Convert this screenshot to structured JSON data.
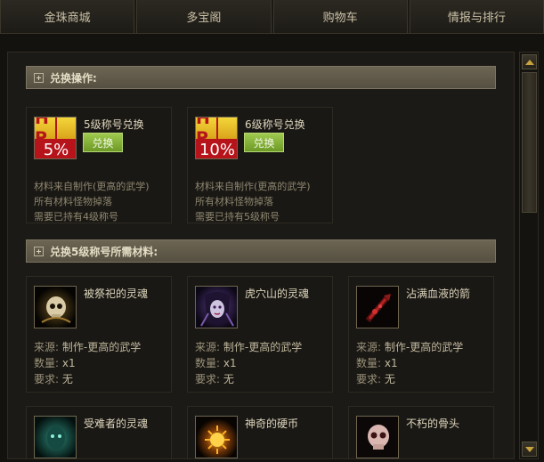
{
  "tabs": [
    "金珠商城",
    "多宝阁",
    "购物车",
    "情报与排行"
  ],
  "sections": {
    "exchange": "兑换操作:",
    "materials": "兑换5级称号所需材料:"
  },
  "exchange_cards": [
    {
      "icon": {
        "top": "H P",
        "value": "5%"
      },
      "title": "5级称号兑换",
      "button": "兑换",
      "desc": [
        "材料来自制作(更高的武学)",
        "所有材料怪物掉落",
        "需要已持有4级称号"
      ]
    },
    {
      "icon": {
        "top": "H P",
        "value": "10%"
      },
      "title": "6级称号兑换",
      "button": "兑换",
      "desc": [
        "材料来自制作(更高的武学)",
        "所有材料怪物掉落",
        "需要已持有5级称号"
      ]
    }
  ],
  "material_labels": {
    "source": "来源:",
    "qty": "数量:",
    "req": "要求:"
  },
  "materials": [
    {
      "name": "被祭祀的灵魂",
      "icon": "skull-soul-icon",
      "source": "制作-更高的武学",
      "qty": "x1",
      "req": "无"
    },
    {
      "name": "虎穴山的灵魂",
      "icon": "demon-face-icon",
      "source": "制作-更高的武学",
      "qty": "x1",
      "req": "无"
    },
    {
      "name": "沾满血液的箭",
      "icon": "bloody-arrow-icon",
      "source": "制作-更高的武学",
      "qty": "x1",
      "req": "无"
    },
    {
      "name": "受难者的灵魂",
      "icon": "green-spirit-icon"
    },
    {
      "name": "神奇的硬币",
      "icon": "glowing-coin-icon"
    },
    {
      "name": "不朽的骨头",
      "icon": "skull-bone-icon"
    }
  ],
  "colors": {
    "accent_green": "#8fbc3e",
    "hp_red": "#b6141a",
    "hp_gold": "#f3d63a",
    "section_bg": "#5f5949"
  }
}
